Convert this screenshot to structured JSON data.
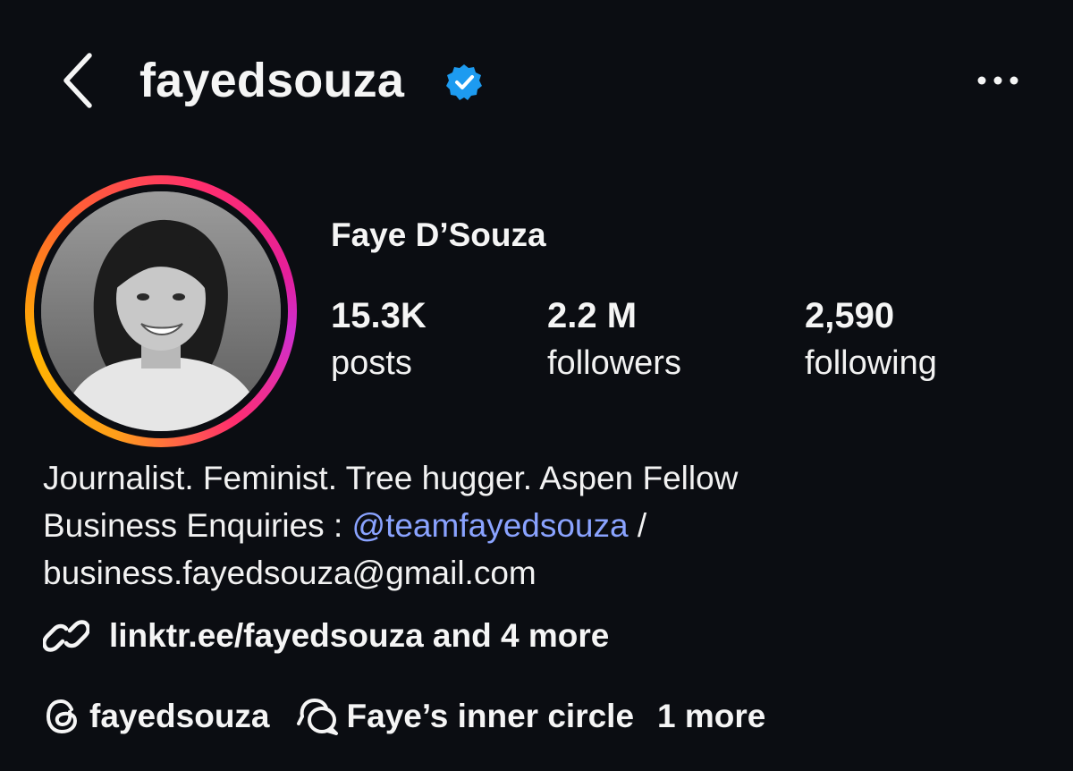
{
  "header": {
    "username": "fayedsouza",
    "verified": true,
    "back_icon": "chevron-left-icon",
    "more_icon": "more-horizontal-icon"
  },
  "profile": {
    "display_name": "Faye D’Souza",
    "avatar_icon": "profile-photo",
    "stats": {
      "posts": {
        "value": "15.3K",
        "label": "posts"
      },
      "followers": {
        "value": "2.2 M",
        "label": "followers"
      },
      "following": {
        "value": "2,590",
        "label": "following"
      }
    },
    "bio": {
      "line1": "Journalist. Feminist. Tree hugger. Aspen Fellow",
      "line2_prefix": "Business Enquiries : ",
      "line2_mention": "@teamfayedsouza",
      "line2_suffix": " /",
      "line3": "business.fayedsouza@gmail.com"
    },
    "link": {
      "text": "linktr.ee/fayedsouza and 4 more",
      "icon": "link-icon"
    },
    "bottom": {
      "threads_handle": "fayedsouza",
      "threads_icon": "threads-icon",
      "channel_name": "Faye’s inner circle",
      "channel_icon": "broadcast-chat-icon",
      "more_label": "1 more"
    }
  },
  "colors": {
    "background": "#0b0d12",
    "text": "#f5f5f5",
    "mention": "#8aa3ff",
    "verified": "#1d9bf0"
  }
}
